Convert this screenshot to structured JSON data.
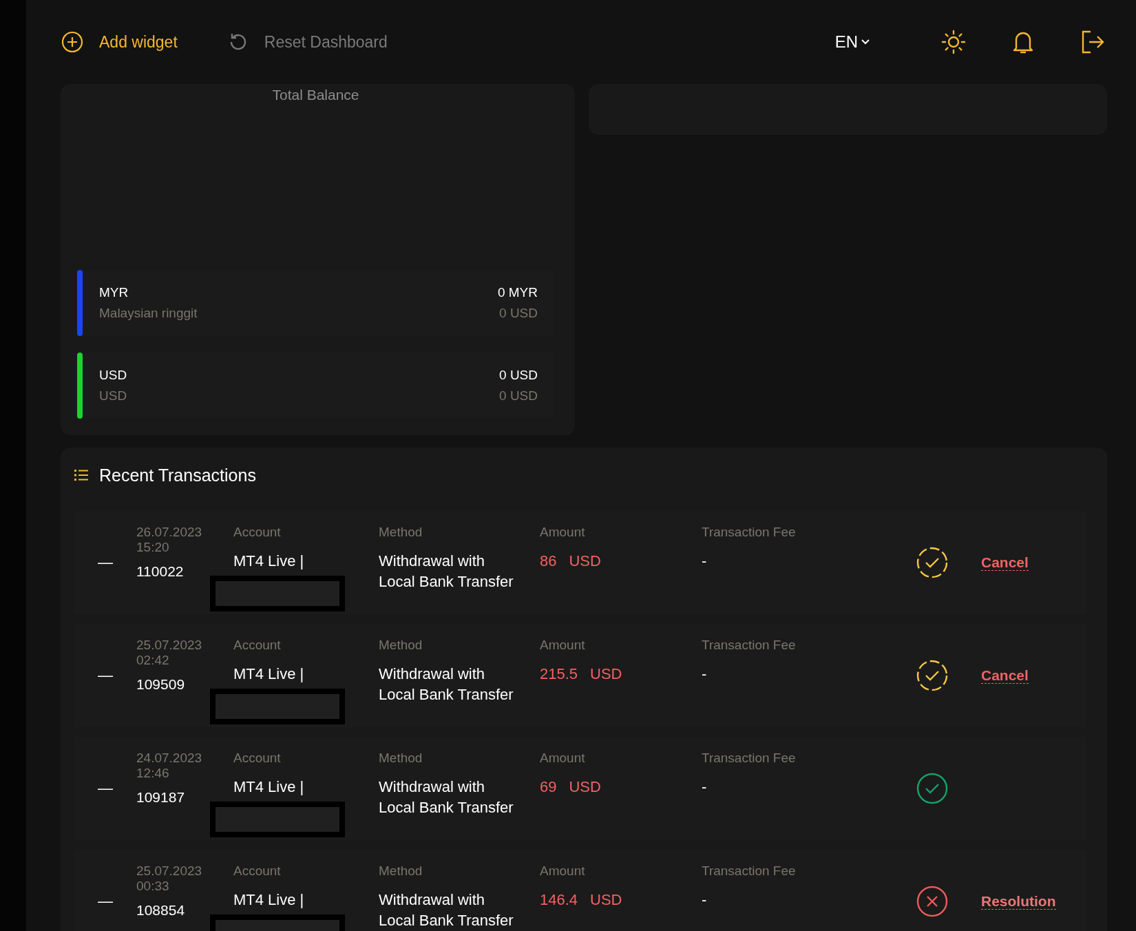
{
  "toolbar": {
    "add_widget": "Add widget",
    "reset_dashboard": "Reset Dashboard",
    "language": "EN"
  },
  "total_balance": {
    "title": "Total Balance",
    "currencies": [
      {
        "code": "MYR",
        "name": "Malaysian ringgit",
        "amount": "0 MYR",
        "usd_amount": "0 USD",
        "color": "#1846f5"
      },
      {
        "code": "USD",
        "name": "USD",
        "amount": "0 USD",
        "usd_amount": "0 USD",
        "color": "#1ed22c"
      }
    ]
  },
  "recent_transactions": {
    "title": "Recent Transactions",
    "rows": [
      {
        "toggle": "—",
        "date": "26.07.2023",
        "time": "15:20",
        "id": "110022",
        "account_label": "Account",
        "account": "MT4 Live |",
        "method_label": "Method",
        "method": "Withdrawal with Local Bank Transfer",
        "amount_label": "Amount",
        "amount": "86",
        "currency": "USD",
        "fee_label": "Transaction Fee",
        "fee": "-",
        "kind": "pending",
        "action": "Cancel"
      },
      {
        "toggle": "—",
        "date": "25.07.2023",
        "time": "02:42",
        "id": "109509",
        "account_label": "Account",
        "account": "MT4 Live |",
        "method_label": "Method",
        "method": "Withdrawal with Local Bank Transfer",
        "amount_label": "Amount",
        "amount": "215.5",
        "currency": "USD",
        "fee_label": "Transaction Fee",
        "fee": "-",
        "kind": "pending",
        "action": "Cancel"
      },
      {
        "toggle": "—",
        "date": "24.07.2023",
        "time": "12:46",
        "id": "109187",
        "account_label": "Account",
        "account": "MT4 Live |",
        "method_label": "Method",
        "method": "Withdrawal with Local Bank Transfer",
        "amount_label": "Amount",
        "amount": "69",
        "currency": "USD",
        "fee_label": "Transaction Fee",
        "fee": "-",
        "kind": "completed"
      },
      {
        "toggle": "—",
        "date": "25.07.2023",
        "time": "00:33",
        "id": "108854",
        "account_label": "Account",
        "account": "MT4 Live |",
        "method_label": "Method",
        "method": "Withdrawal with Local Bank Transfer",
        "amount_label": "Amount",
        "amount": "146.4",
        "currency": "USD",
        "fee_label": "Transaction Fee",
        "fee": "-",
        "kind": "failed",
        "action": "Resolution"
      }
    ]
  }
}
